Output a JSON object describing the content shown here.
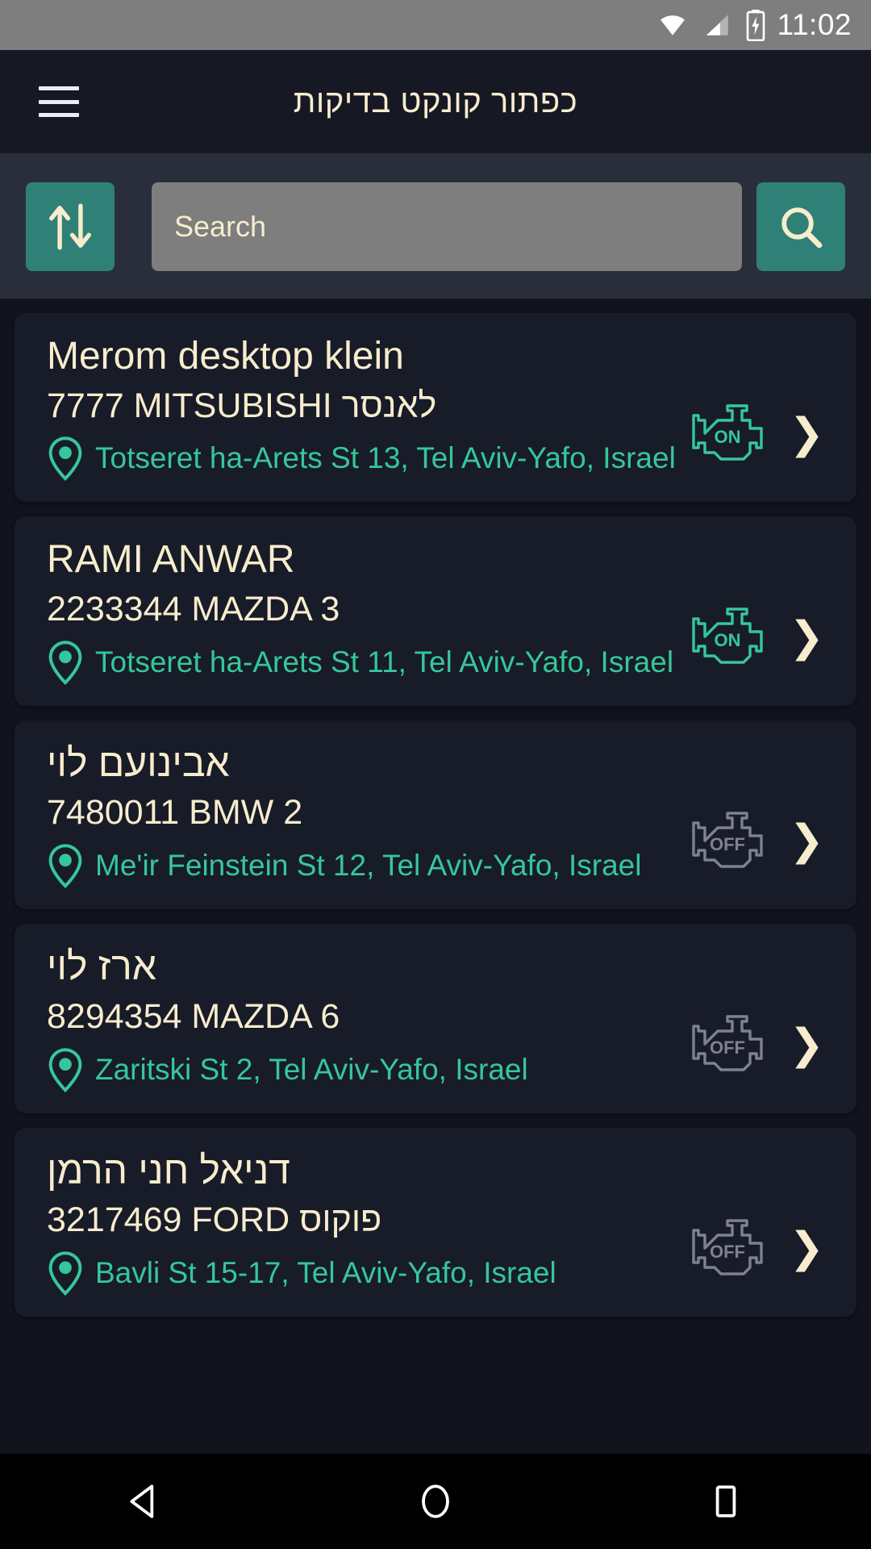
{
  "status_bar": {
    "time": "11:02",
    "icons": [
      "wifi-icon",
      "signal-icon",
      "battery-charging-icon"
    ]
  },
  "app_bar": {
    "menu_icon": "hamburger-menu-icon",
    "title": "כפתור קונקט בדיקות"
  },
  "search": {
    "sort_icon": "sort-arrows-icon",
    "placeholder": "Search",
    "value": "",
    "search_icon": "magnifier-icon",
    "accent_color": "#2f8076"
  },
  "colors": {
    "background": "#11131d",
    "card": "#181b28",
    "panel": "#2a2e3b",
    "cream": "#f7eccd",
    "teal": "#35c79a",
    "gray": "#7e8290"
  },
  "list": {
    "items": [
      {
        "name": "Merom desktop klein",
        "name_rtl": false,
        "vehicle": "7777  MITSUBISHI לאנסר",
        "address": "Totseret ha-Arets St 13, Tel Aviv-Yafo, Israel",
        "engine_status": "ON",
        "engine_icon": "engine-on-icon",
        "pin_icon": "location-pin-icon",
        "chevron_icon": "chevron-right-icon"
      },
      {
        "name": "RAMI ANWAR",
        "name_rtl": false,
        "vehicle": "2233344  MAZDA 3",
        "address": "Totseret ha-Arets St 11, Tel Aviv-Yafo, Israel",
        "engine_status": "ON",
        "engine_icon": "engine-on-icon",
        "pin_icon": "location-pin-icon",
        "chevron_icon": "chevron-right-icon"
      },
      {
        "name": "אבינועם לוי",
        "name_rtl": true,
        "vehicle": "7480011  BMW 2",
        "address": "Me'ir Feinstein St 12, Tel Aviv-Yafo, Israel",
        "engine_status": "OFF",
        "engine_icon": "engine-off-icon",
        "pin_icon": "location-pin-icon",
        "chevron_icon": "chevron-right-icon"
      },
      {
        "name": "ארז לוי",
        "name_rtl": true,
        "vehicle": "8294354  MAZDA 6",
        "address": "Zaritski St 2, Tel Aviv-Yafo, Israel",
        "engine_status": "OFF",
        "engine_icon": "engine-off-icon",
        "pin_icon": "location-pin-icon",
        "chevron_icon": "chevron-right-icon"
      },
      {
        "name": "דניאל חני הרמן",
        "name_rtl": true,
        "vehicle": "3217469  FORD פוקוס",
        "address": "Bavli St 15-17, Tel Aviv-Yafo, Israel",
        "engine_status": "OFF",
        "engine_icon": "engine-off-icon",
        "pin_icon": "location-pin-icon",
        "chevron_icon": "chevron-right-icon"
      }
    ]
  },
  "nav_bar": {
    "back_icon": "back-triangle-icon",
    "home_icon": "home-circle-icon",
    "recents_icon": "recents-square-icon"
  }
}
